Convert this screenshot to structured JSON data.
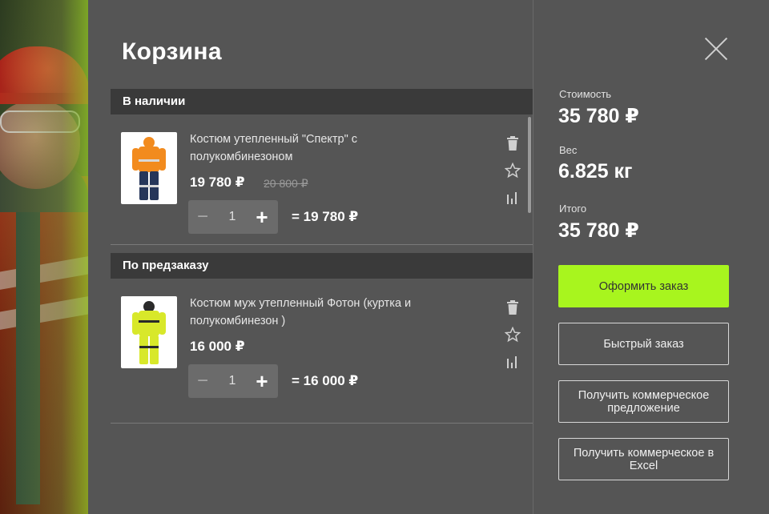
{
  "cart": {
    "title": "Корзина",
    "sections": [
      {
        "title": "В наличии",
        "items": [
          {
            "name": "Костюм утепленный \"Спектр\" с полукомбинезоном",
            "price": "19 780 ₽",
            "old_price": "20 800 ₽",
            "quantity": "1",
            "total": "= 19 780 ₽"
          }
        ]
      },
      {
        "title": "По предзаказу",
        "items": [
          {
            "name": "Костюм муж утепленный Фотон (куртка и полукомбинезон )",
            "price": "16 000 ₽",
            "old_price": "",
            "quantity": "1",
            "total": "= 16 000 ₽"
          }
        ]
      }
    ],
    "stepper": {
      "minus": "−",
      "plus": "+"
    }
  },
  "summary": {
    "cost_label": "Стоимость",
    "cost_value": "35 780 ₽",
    "weight_label": "Вес",
    "weight_value": "6.825 кг",
    "total_label": "Итого",
    "total_value": "35 780 ₽"
  },
  "buttons": {
    "checkout": "Оформить заказ",
    "quick_order": "Быстрый заказ",
    "commercial_offer": "Получить коммерческое предложение",
    "commercial_excel": "Получить коммерческое в Excel"
  },
  "icons": {
    "trash": "trash-icon",
    "favorite": "star-icon",
    "compare": "bar-chart-icon",
    "close": "close-icon"
  },
  "colors": {
    "panel": "#555555",
    "section_header": "#3a3a3a",
    "accent": "#a8f51e"
  }
}
